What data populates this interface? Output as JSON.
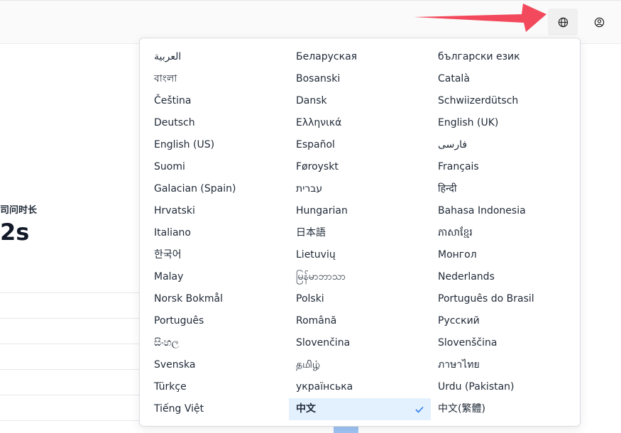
{
  "background": {
    "metric_label": "司问时长",
    "metric_value": "2s"
  },
  "header": {
    "language_icon": "globe-icon",
    "account_icon": "user-circle-icon"
  },
  "language_menu": {
    "selected": "中文",
    "items": [
      "العربية",
      "Беларуская",
      "български език",
      "বাংলা",
      "Bosanski",
      "Català",
      "Čeština",
      "Dansk",
      "Schwiizerdütsch",
      "Deutsch",
      "Ελληνικά",
      "English (UK)",
      "English (US)",
      "Español",
      "فارسی",
      "Suomi",
      "Føroyskt",
      "Français",
      "Galacian (Spain)",
      "עברית",
      "हिन्दी",
      "Hrvatski",
      "Hungarian",
      "Bahasa Indonesia",
      "Italiano",
      "日本語",
      "ភាសាខ្មែរ",
      "한국어",
      "Lietuvių",
      "Монгол",
      "Malay",
      "မြန်မာဘာသာ",
      "Nederlands",
      "Norsk Bokmål",
      "Polski",
      "Português do Brasil",
      "Português",
      "Română",
      "Русский",
      "සිංහල",
      "Slovenčina",
      "Slovenščina",
      "Svenska",
      "தமிழ்",
      "ภาษาไทย",
      "Türkçe",
      "українська",
      "Urdu (Pakistan)",
      "Tiếng Việt",
      "中文",
      "中文(繁體)"
    ]
  },
  "colors": {
    "selected_bg": "#e3f0fd",
    "check": "#2b7de9",
    "arrow": "#f24a5c"
  }
}
